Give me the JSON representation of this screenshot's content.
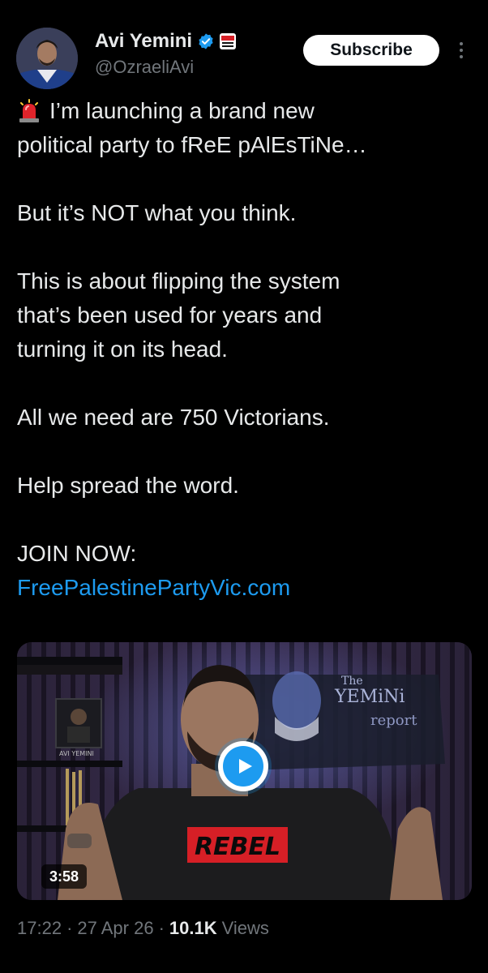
{
  "author": {
    "display_name": "Avi Yemini",
    "handle": "@OzraeliAvi",
    "avatar_icon": "profile-photo",
    "verified_icon": "verified-badge-icon",
    "affiliate_icon": "rebel-news-badge-icon"
  },
  "actions": {
    "subscribe_label": "Subscribe",
    "more_icon": "more-options-icon"
  },
  "post": {
    "lead_icon": "police-light-emoji",
    "lines": [
      "I’m launching a brand new",
      "political party to fReE pAlEsTiNe…",
      "But it’s NOT what you think.",
      "This is about flipping the system",
      "that’s been used for years and",
      "turning it on its head.",
      "All we need are 750 Victorians.",
      "Help spread the word.",
      "JOIN NOW:"
    ],
    "link": "FreePalestinePartyVic.com"
  },
  "media": {
    "duration": "3:58",
    "play_icon": "play-icon",
    "shirt_text": "REBEL",
    "backdrop_text_1": "The",
    "backdrop_text_2": "YEMiNi",
    "backdrop_text_3": "report",
    "poster_text": "AVI YEMINI"
  },
  "meta": {
    "time": "17:22",
    "separator": "·",
    "date": "27 Apr 26",
    "views_count": "10.1K",
    "views_label": "Views"
  },
  "colors": {
    "background": "#000000",
    "text": "#e7e9ea",
    "muted": "#71767b",
    "link": "#1d9bf0",
    "verified": "#1d9bf0",
    "rebel_red": "#d61f26"
  }
}
